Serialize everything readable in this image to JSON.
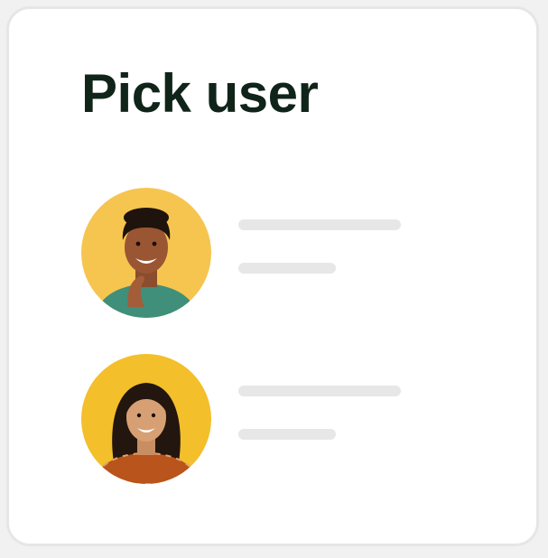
{
  "dialog": {
    "title": "Pick user"
  },
  "users": [
    {
      "avatar_icon": "person-avatar-icon",
      "avatar_bg": "#f6c54f"
    },
    {
      "avatar_icon": "person-avatar-icon",
      "avatar_bg": "#f3bf2a"
    }
  ],
  "colors": {
    "title_text": "#10241a",
    "placeholder_line": "#e7e7e7",
    "card_border": "#e6e6e6"
  }
}
